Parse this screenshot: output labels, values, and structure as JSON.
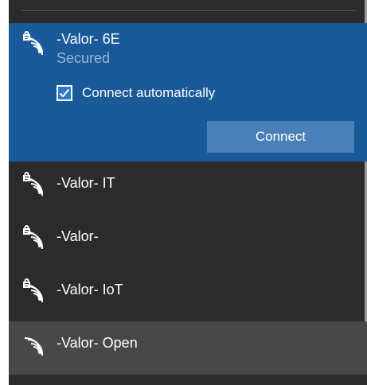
{
  "networks": {
    "selected": {
      "name": "-Valor- 6E",
      "status": "Secured",
      "secured": true,
      "auto_connect_label": "Connect automatically",
      "auto_connect_checked": true,
      "connect_label": "Connect",
      "icon": "wifi-secured-icon"
    },
    "items": [
      {
        "name": "-Valor- IT",
        "secured": true,
        "icon": "wifi-secured-icon"
      },
      {
        "name": "-Valor-",
        "secured": true,
        "icon": "wifi-secured-icon"
      },
      {
        "name": "-Valor- IoT",
        "secured": true,
        "icon": "wifi-secured-icon"
      },
      {
        "name": "-Valor- Open",
        "secured": false,
        "icon": "wifi-icon",
        "hovered": true
      }
    ]
  },
  "colors": {
    "flyout_bg": "#2b2b2b",
    "selected_bg": "#1a5a99",
    "button_bg": "#4a80b8",
    "hover_bg": "#484848",
    "status_text": "#9cb6d2"
  }
}
